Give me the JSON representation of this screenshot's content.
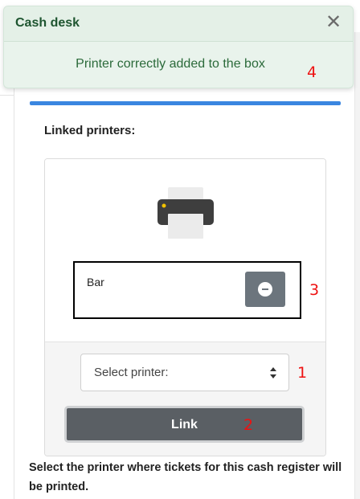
{
  "toast": {
    "title": "Cash desk",
    "message": "Printer correctly added to the box",
    "close_glyph": "✕",
    "annotation": "4"
  },
  "section": {
    "linked_label": "Linked printers:"
  },
  "linked_printer": {
    "name": "Bar",
    "icon": "printer-icon",
    "remove_icon": "minus-circle-icon",
    "annotation": "3"
  },
  "printer_select": {
    "value": "Select printer:",
    "annotation": "1"
  },
  "link_button": {
    "label": "Link",
    "annotation": "2"
  },
  "help": {
    "text": "Select the printer where tickets for this cash register will be printed."
  },
  "colors": {
    "accent_bar": "#3a86e0",
    "toast_bg": "#e9f3ec",
    "toast_text": "#2b6a3a",
    "button_gray": "#6c757d",
    "annotation_red": "#e11111"
  }
}
